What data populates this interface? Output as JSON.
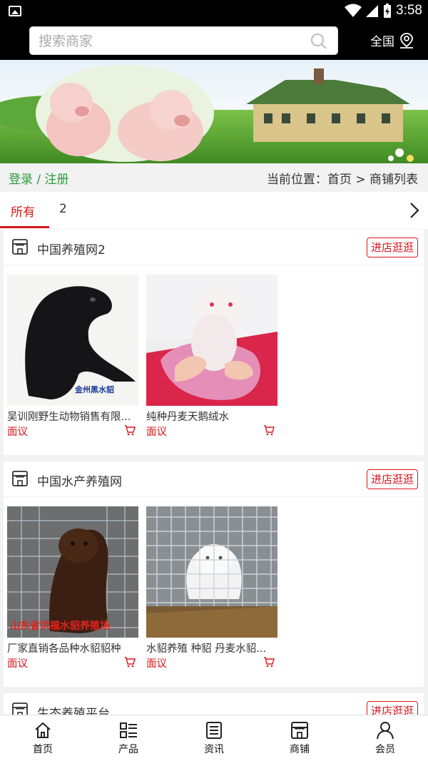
{
  "status_bar": {
    "time": "3:58"
  },
  "search": {
    "placeholder": "搜索商家",
    "region": "全国"
  },
  "breadcrumb": {
    "login": "登录 / 注册",
    "location": "当前位置：首页 > 商铺列表"
  },
  "tabs": [
    {
      "label": "所有",
      "active": true
    },
    {
      "label": "2",
      "active": false
    }
  ],
  "stores": [
    {
      "name": "中国养殖网2",
      "enter_label": "进店逛逛",
      "products": [
        {
          "name": "吴训刚野生动物销售有限...",
          "price": "面议",
          "image": "black-mink-photo",
          "watermark": "金州黑水貂"
        },
        {
          "name": "纯种丹麦天鹅绒水",
          "price": "面议",
          "image": "white-ferret-photo"
        }
      ]
    },
    {
      "name": "中国水产养殖网",
      "enter_label": "进店逛逛",
      "products": [
        {
          "name": "厂家直销各品种水貂貂种",
          "price": "面议",
          "image": "brown-mink-cage-photo",
          "watermark": "山东省洪福水貂养殖场"
        },
        {
          "name": "水貂养殖 种貂 丹麦水貂...",
          "price": "面议",
          "image": "white-mink-cage-photo"
        }
      ]
    },
    {
      "name": "生态养殖平台",
      "enter_label": "进店逛逛",
      "products": []
    }
  ],
  "bottom_nav": [
    {
      "label": "首页",
      "icon": "home-icon"
    },
    {
      "label": "产品",
      "icon": "product-list-icon"
    },
    {
      "label": "资讯",
      "icon": "news-icon"
    },
    {
      "label": "商铺",
      "icon": "shop-icon"
    },
    {
      "label": "会员",
      "icon": "user-icon"
    }
  ],
  "colors": {
    "accent": "#d8171c",
    "login_green": "#2a9b3a",
    "header_bg": "#000000"
  }
}
